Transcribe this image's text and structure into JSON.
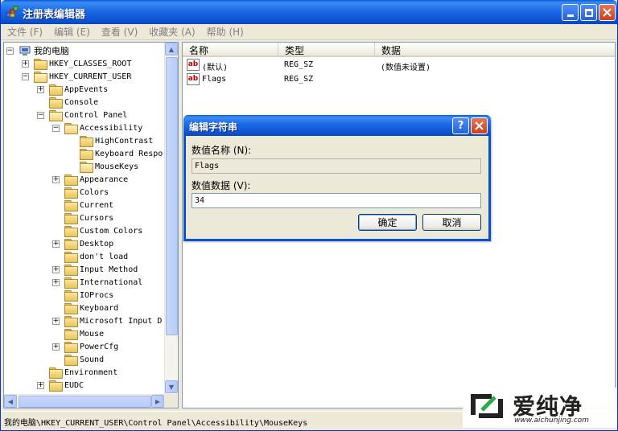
{
  "window": {
    "title": "注册表编辑器"
  },
  "menu": [
    "文件 (F)",
    "编辑 (E)",
    "查看 (V)",
    "收藏夹 (A)",
    "帮助 (H)"
  ],
  "tree": [
    {
      "label": "我的电脑",
      "depth": 0,
      "expander": "−",
      "icon": "computer-icon"
    },
    {
      "label": "HKEY_CLASSES_ROOT",
      "depth": 1,
      "expander": "+",
      "icon": "folder"
    },
    {
      "label": "HKEY_CURRENT_USER",
      "depth": 1,
      "expander": "−",
      "icon": "folder-open"
    },
    {
      "label": "AppEvents",
      "depth": 2,
      "expander": "+",
      "icon": "folder"
    },
    {
      "label": "Console",
      "depth": 2,
      "expander": "",
      "icon": "folder"
    },
    {
      "label": "Control Panel",
      "depth": 2,
      "expander": "−",
      "icon": "folder-open"
    },
    {
      "label": "Accessibility",
      "depth": 3,
      "expander": "−",
      "icon": "folder-open"
    },
    {
      "label": "HighContrast",
      "depth": 4,
      "expander": "",
      "icon": "folder"
    },
    {
      "label": "Keyboard Respo",
      "depth": 4,
      "expander": "",
      "icon": "folder"
    },
    {
      "label": "MouseKeys",
      "depth": 4,
      "expander": "",
      "icon": "folder-open"
    },
    {
      "label": "Appearance",
      "depth": 3,
      "expander": "+",
      "icon": "folder"
    },
    {
      "label": "Colors",
      "depth": 3,
      "expander": "",
      "icon": "folder"
    },
    {
      "label": "Current",
      "depth": 3,
      "expander": "",
      "icon": "folder"
    },
    {
      "label": "Cursors",
      "depth": 3,
      "expander": "",
      "icon": "folder"
    },
    {
      "label": "Custom Colors",
      "depth": 3,
      "expander": "",
      "icon": "folder"
    },
    {
      "label": "Desktop",
      "depth": 3,
      "expander": "+",
      "icon": "folder"
    },
    {
      "label": "don't load",
      "depth": 3,
      "expander": "",
      "icon": "folder"
    },
    {
      "label": "Input Method",
      "depth": 3,
      "expander": "+",
      "icon": "folder"
    },
    {
      "label": "International",
      "depth": 3,
      "expander": "+",
      "icon": "folder"
    },
    {
      "label": "IOProcs",
      "depth": 3,
      "expander": "",
      "icon": "folder"
    },
    {
      "label": "Keyboard",
      "depth": 3,
      "expander": "",
      "icon": "folder"
    },
    {
      "label": "Microsoft Input D",
      "depth": 3,
      "expander": "+",
      "icon": "folder"
    },
    {
      "label": "Mouse",
      "depth": 3,
      "expander": "",
      "icon": "folder"
    },
    {
      "label": "PowerCfg",
      "depth": 3,
      "expander": "+",
      "icon": "folder"
    },
    {
      "label": "Sound",
      "depth": 3,
      "expander": "",
      "icon": "folder"
    },
    {
      "label": "Environment",
      "depth": 2,
      "expander": "",
      "icon": "folder"
    },
    {
      "label": "EUDC",
      "depth": 2,
      "expander": "+",
      "icon": "folder"
    }
  ],
  "list": {
    "columns": [
      "名称",
      "类型",
      "数据"
    ],
    "rows": [
      {
        "name": "(默认)",
        "type": "REG_SZ",
        "data": "(数值未设置)"
      },
      {
        "name": "Flags",
        "type": "REG_SZ",
        "data": ""
      }
    ]
  },
  "dialog": {
    "title": "编辑字符串",
    "help_label": "?",
    "name_label": "数值名称 (N):",
    "name_value": "Flags",
    "data_label": "数值数据 (V):",
    "data_value": "34",
    "ok_label": "确定",
    "cancel_label": "取消"
  },
  "status": {
    "path": "我的电脑\\HKEY_CURRENT_USER\\Control Panel\\Accessibility\\MouseKeys"
  },
  "watermark": {
    "text": "爱纯净",
    "url": "www.aichunjing.com"
  },
  "colors": {
    "titlebar": "#1d6ae6",
    "border": "#0831d9",
    "face": "#ece9d8"
  }
}
